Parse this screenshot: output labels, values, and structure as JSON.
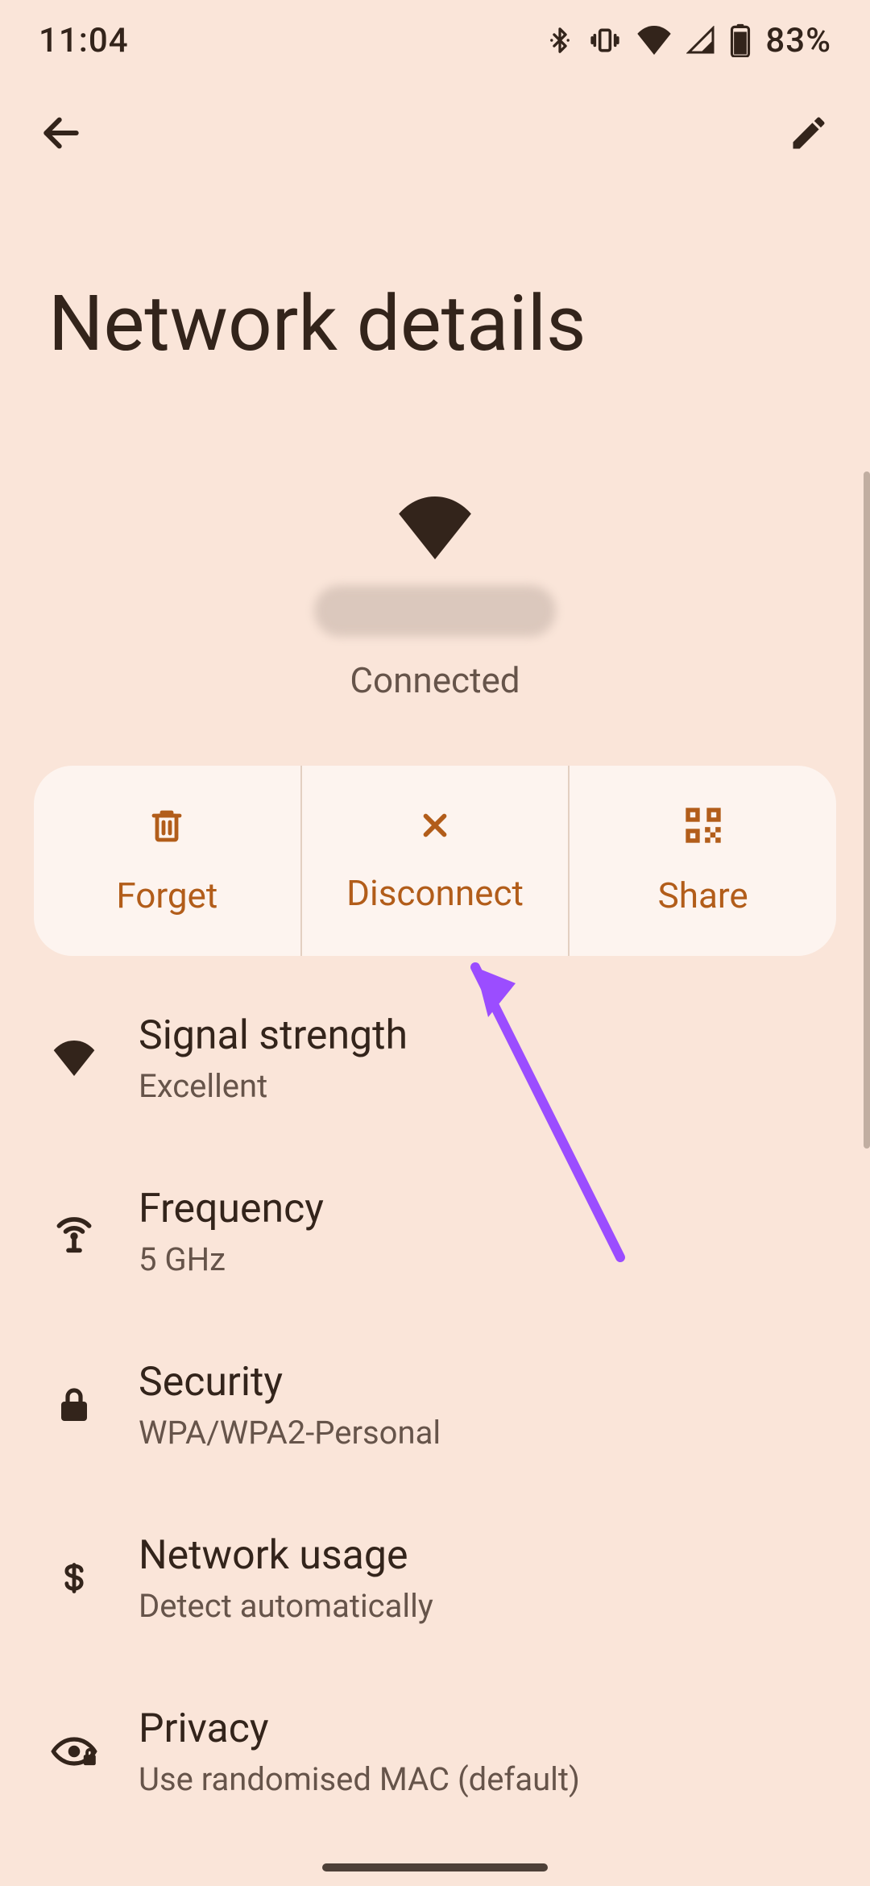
{
  "status_bar": {
    "time": "11:04",
    "battery": "83%"
  },
  "header": {
    "title": "Network details"
  },
  "wifi": {
    "status": "Connected"
  },
  "actions": {
    "forget": "Forget",
    "disconnect": "Disconnect",
    "share": "Share"
  },
  "rows": {
    "signal": {
      "title": "Signal strength",
      "sub": "Excellent"
    },
    "freq": {
      "title": "Frequency",
      "sub": "5 GHz"
    },
    "security": {
      "title": "Security",
      "sub": "WPA/WPA2-Personal"
    },
    "usage": {
      "title": "Network usage",
      "sub": "Detect automatically"
    },
    "privacy": {
      "title": "Privacy",
      "sub": "Use randomised MAC (default)"
    }
  }
}
